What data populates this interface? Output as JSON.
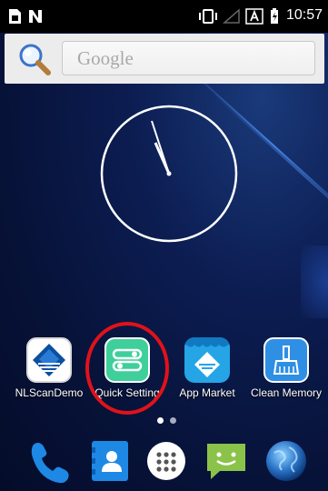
{
  "status_bar": {
    "time": "10:57",
    "icons": [
      "sim-card-icon",
      "nfc-icon",
      "vibrate-icon",
      "no-signal-icon",
      "auto-rotate-icon",
      "battery-charging-icon"
    ]
  },
  "search": {
    "placeholder": "Google",
    "icon": "search-icon"
  },
  "clock": {
    "time": "10:57",
    "style": "analog"
  },
  "apps": [
    {
      "label": "NLScanDemo",
      "icon": "nlscan-logo-icon"
    },
    {
      "label": "Quick Setting",
      "icon": "quick-setting-toggle-icon",
      "highlighted": true
    },
    {
      "label": "App Market",
      "icon": "app-market-icon"
    },
    {
      "label": "Clean Memory",
      "icon": "broom-icon"
    }
  ],
  "page_indicator": {
    "pages": 2,
    "current": 1
  },
  "dock": [
    {
      "icon": "phone-icon"
    },
    {
      "icon": "contacts-icon"
    },
    {
      "icon": "app-drawer-icon"
    },
    {
      "icon": "messaging-icon"
    },
    {
      "icon": "browser-globe-icon"
    }
  ],
  "colors": {
    "highlight_ring": "#e0121a",
    "wallpaper": "#0c1d52",
    "quick_setting": "#3ecf9a",
    "dock_phone": "#1e88e5"
  }
}
